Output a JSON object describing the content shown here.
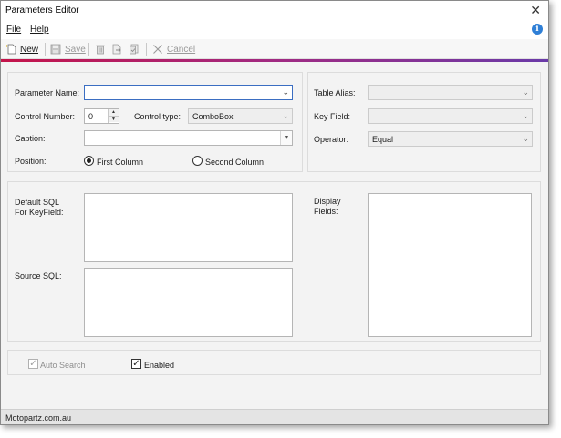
{
  "window": {
    "title": "Parameters Editor",
    "close_glyph": "✕"
  },
  "menu": {
    "file": "File",
    "help": "Help",
    "info_glyph": "i"
  },
  "toolbar": {
    "new_label": "New",
    "save_label": "Save",
    "cancel_label": "Cancel",
    "icons": {
      "new": "new-document-icon",
      "save": "save-icon",
      "delete": "delete-icon",
      "export": "export-icon",
      "copy": "copy-icon",
      "cancel": "cancel-x-icon"
    }
  },
  "form": {
    "parameter_name_label": "Parameter Name:",
    "parameter_name_value": "",
    "control_number_label": "Control Number:",
    "control_number_value": "0",
    "control_type_label": "Control type:",
    "control_type_value": "ComboBox",
    "caption_label": "Caption:",
    "caption_value": "",
    "position_label": "Position:",
    "position_options": [
      "First Column",
      "Second Column"
    ],
    "position_selected": "First Column",
    "table_alias_label": "Table Alias:",
    "table_alias_value": "",
    "key_field_label": "Key Field:",
    "key_field_value": "",
    "operator_label": "Operator:",
    "operator_value": "Equal",
    "default_sql_label_1": "Default SQL",
    "default_sql_label_2": "For KeyField:",
    "source_sql_label": "Source SQL:",
    "display_fields_label_1": "Display",
    "display_fields_label_2": "Fields:",
    "auto_search_label": "Auto Search",
    "auto_search_checked": true,
    "enabled_label": "Enabled",
    "enabled_checked": true
  },
  "status": {
    "text": "Motopartz.com.au"
  },
  "colors": {
    "accent_start": "#c4144a",
    "accent_end": "#6a3aa8",
    "info_blue": "#2f7fd6",
    "focus_border": "#3b6ec2"
  }
}
